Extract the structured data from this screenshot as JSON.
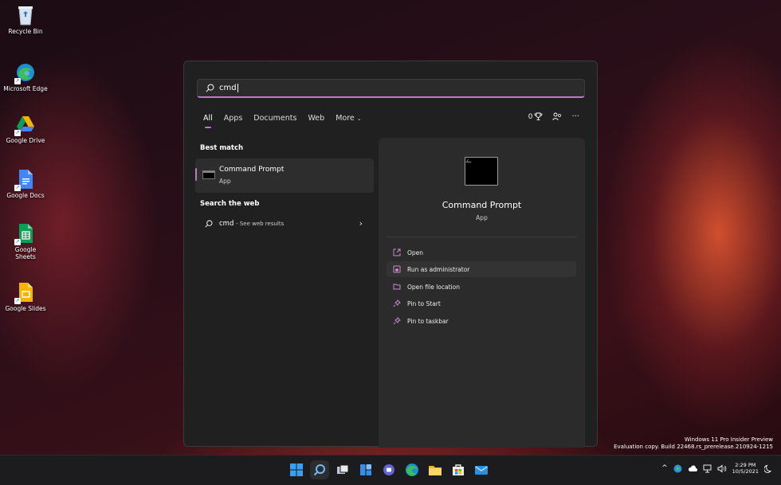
{
  "desktop": {
    "icons": [
      {
        "label": "Recycle Bin",
        "icon": "recycle-bin-icon"
      },
      {
        "label": "Microsoft Edge",
        "icon": "edge-icon"
      },
      {
        "label": "Google Drive",
        "icon": "google-drive-icon"
      },
      {
        "label": "Google Docs",
        "icon": "google-docs-icon"
      },
      {
        "label": "Google Sheets",
        "icon": "google-sheets-icon"
      },
      {
        "label": "Google Slides",
        "icon": "google-slides-icon"
      }
    ]
  },
  "search": {
    "query": "cmd",
    "tabs": [
      {
        "label": "All",
        "active": true
      },
      {
        "label": "Apps"
      },
      {
        "label": "Documents"
      },
      {
        "label": "Web"
      },
      {
        "label": "More"
      }
    ],
    "rewards_count": "0",
    "icons": {
      "rewards": "trophy-icon",
      "account": "account-icon",
      "more": "more-options-icon"
    }
  },
  "results": {
    "best_match_title": "Best match",
    "best_match": {
      "name": "Command Prompt",
      "type": "App"
    },
    "web_title": "Search the web",
    "web_result": {
      "query": "cmd",
      "suffix": "- See web results"
    }
  },
  "details": {
    "name": "Command Prompt",
    "type": "App",
    "actions": [
      {
        "label": "Open",
        "icon": "open-icon"
      },
      {
        "label": "Run as administrator",
        "icon": "admin-shield-icon",
        "hovered": true
      },
      {
        "label": "Open file location",
        "icon": "folder-icon"
      },
      {
        "label": "Pin to Start",
        "icon": "pin-icon"
      },
      {
        "label": "Pin to taskbar",
        "icon": "pin-icon"
      }
    ]
  },
  "watermark": {
    "line1": "Windows 11 Pro Insider Preview",
    "line2": "Evaluation copy. Build 22468.rs_prerelease.210924-1215"
  },
  "taskbar": {
    "apps": [
      "start-icon",
      "search-icon",
      "task-view-icon",
      "widgets-icon",
      "teams-chat-icon",
      "edge-icon",
      "file-explorer-icon",
      "microsoft-store-icon",
      "mail-icon"
    ],
    "time": "2:29 PM",
    "date": "10/5/2021"
  },
  "colors": {
    "accent": "#c276c8",
    "panel": "#202020",
    "details": "#2b2b2b"
  }
}
